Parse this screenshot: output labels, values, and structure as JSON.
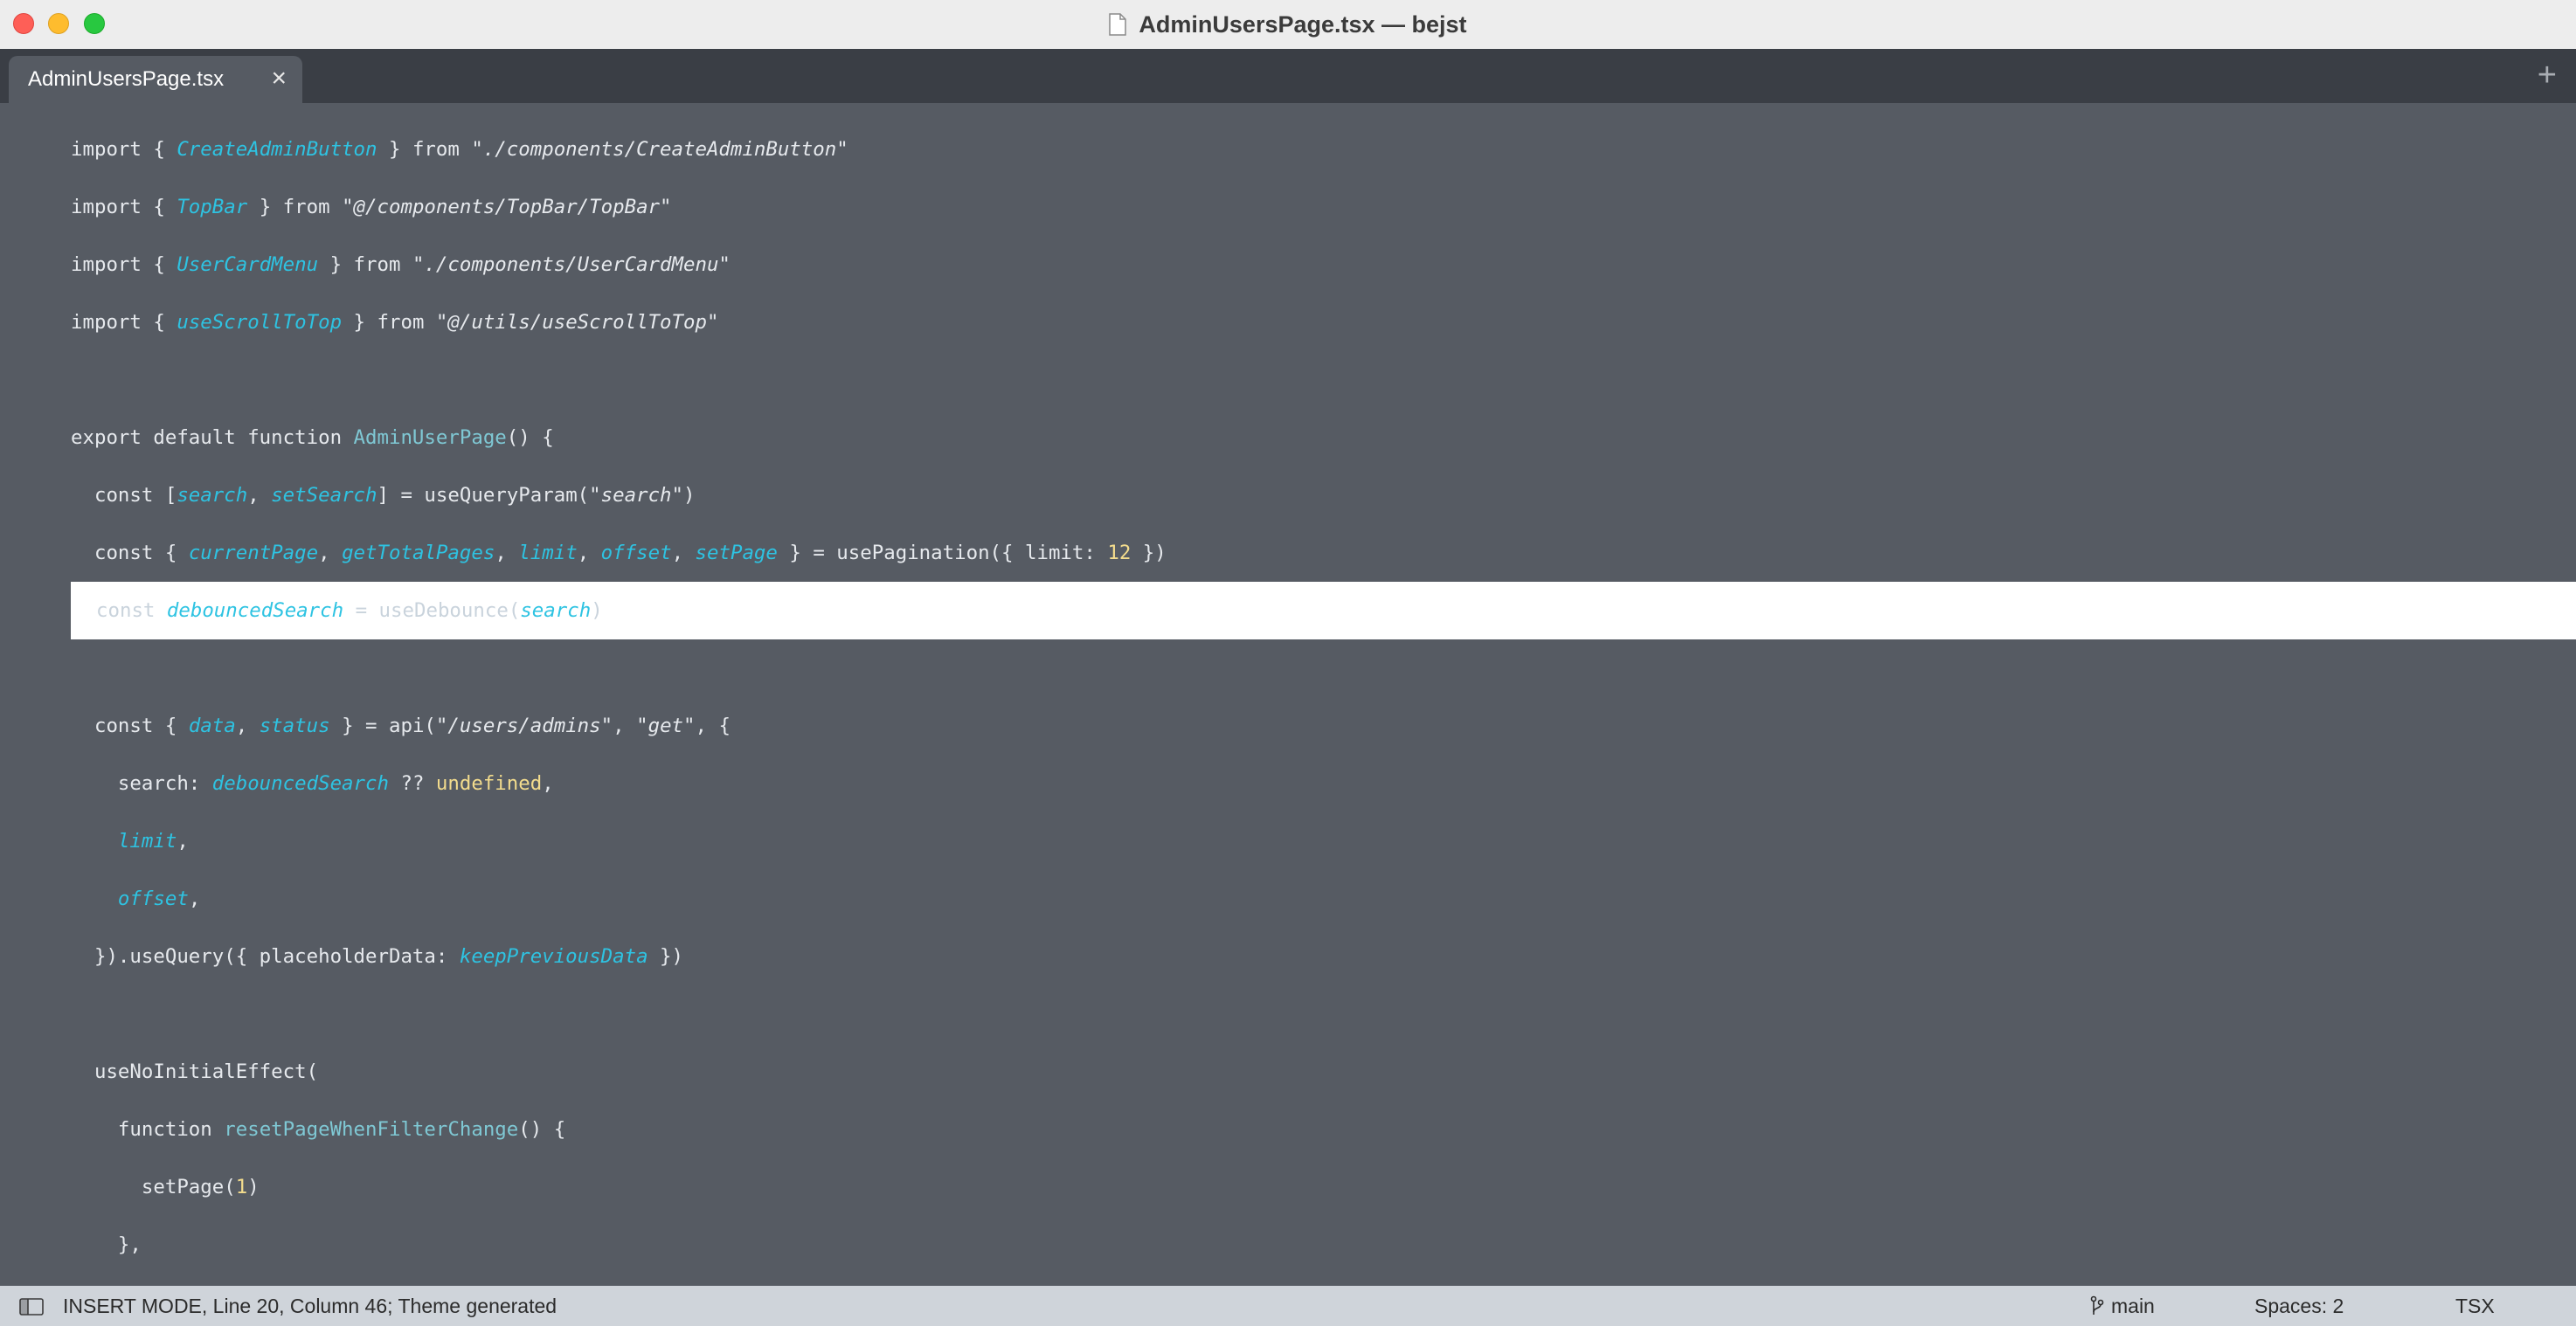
{
  "window": {
    "title": "AdminUsersPage.tsx — bejst"
  },
  "tabs": [
    {
      "label": "AdminUsersPage.tsx",
      "close": "×"
    }
  ],
  "new_tab": "+",
  "code_lines": [
    [
      [
        "p",
        "import { "
      ],
      [
        "i",
        "CreateAdminButton"
      ],
      [
        "p",
        " } from "
      ],
      [
        "s",
        "\"./components/CreateAdminButton\""
      ]
    ],
    [
      [
        "p",
        "import { "
      ],
      [
        "i",
        "TopBar"
      ],
      [
        "p",
        " } from "
      ],
      [
        "s",
        "\"@/components/TopBar/TopBar\""
      ]
    ],
    [
      [
        "p",
        "import { "
      ],
      [
        "i",
        "UserCardMenu"
      ],
      [
        "p",
        " } from "
      ],
      [
        "s",
        "\"./components/UserCardMenu\""
      ]
    ],
    [
      [
        "p",
        "import { "
      ],
      [
        "i",
        "useScrollToTop"
      ],
      [
        "p",
        " } from "
      ],
      [
        "s",
        "\"@/utils/useScrollToTop\""
      ]
    ],
    [],
    [
      [
        "p",
        "export default function "
      ],
      [
        "f",
        "AdminUserPage"
      ],
      [
        "p",
        "() {"
      ]
    ],
    [
      [
        "p",
        "  const ["
      ],
      [
        "i",
        "search"
      ],
      [
        "p",
        ", "
      ],
      [
        "i",
        "setSearch"
      ],
      [
        "p",
        "] = useQueryParam("
      ],
      [
        "s",
        "\"search\""
      ],
      [
        "p",
        ")"
      ]
    ],
    [
      [
        "p",
        "  const { "
      ],
      [
        "i",
        "currentPage"
      ],
      [
        "p",
        ", "
      ],
      [
        "i",
        "getTotalPages"
      ],
      [
        "p",
        ", "
      ],
      [
        "i",
        "limit"
      ],
      [
        "p",
        ", "
      ],
      [
        "i",
        "offset"
      ],
      [
        "p",
        ", "
      ],
      [
        "i",
        "setPage"
      ],
      [
        "p",
        " } = usePagination({ limit: "
      ],
      [
        "n",
        "12"
      ],
      [
        "p",
        " })"
      ]
    ],
    [
      [
        "p",
        "const "
      ],
      [
        "i",
        "debouncedSearch"
      ],
      [
        "p",
        " = useDebounce("
      ],
      [
        "i",
        "search"
      ],
      [
        "p",
        ")"
      ]
    ],
    [],
    [
      [
        "p",
        "  const { "
      ],
      [
        "i",
        "data"
      ],
      [
        "p",
        ", "
      ],
      [
        "i",
        "status"
      ],
      [
        "p",
        " } = api("
      ],
      [
        "s",
        "\"/users/admins\""
      ],
      [
        "p",
        ", "
      ],
      [
        "s",
        "\"get\""
      ],
      [
        "p",
        ", {"
      ]
    ],
    [
      [
        "p",
        "    search: "
      ],
      [
        "i",
        "debouncedSearch"
      ],
      [
        "p",
        " ?? "
      ],
      [
        "n",
        "undefined"
      ],
      [
        "p",
        ","
      ]
    ],
    [
      [
        "p",
        "    "
      ],
      [
        "i",
        "limit"
      ],
      [
        "p",
        ","
      ]
    ],
    [
      [
        "p",
        "    "
      ],
      [
        "i",
        "offset"
      ],
      [
        "p",
        ","
      ]
    ],
    [
      [
        "p",
        "  }).useQuery({ placeholderData: "
      ],
      [
        "i",
        "keepPreviousData"
      ],
      [
        "p",
        " })"
      ]
    ],
    [],
    [
      [
        "p",
        "  useNoInitialEffect("
      ]
    ],
    [
      [
        "p",
        "    function "
      ],
      [
        "f",
        "resetPageWhenFilterChange"
      ],
      [
        "p",
        "() {"
      ]
    ],
    [
      [
        "p",
        "      setPage("
      ],
      [
        "n",
        "1"
      ],
      [
        "p",
        ")"
      ]
    ],
    [
      [
        "p",
        "    },"
      ]
    ]
  ],
  "current_line_index": 8,
  "statusbar": {
    "text": "INSERT MODE, Line 20, Column 46; Theme generated",
    "branch": "main",
    "spaces": "Spaces: 2",
    "syntax": "TSX"
  },
  "colors": {
    "editor_bg": "#565b63",
    "identifier": "#2ec3e2",
    "function_name": "#7fc8d4",
    "number": "#f3dc8d",
    "current_line_bg": "#ffffff"
  }
}
